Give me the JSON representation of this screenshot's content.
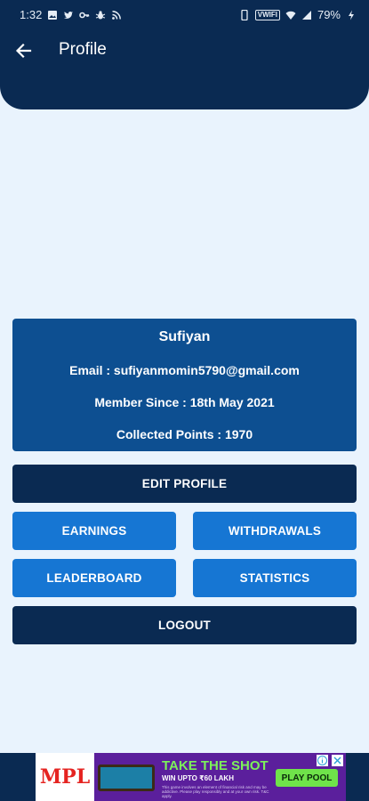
{
  "status_bar": {
    "time": "1:32",
    "carrier_badge": "VWIFI",
    "battery": "79%"
  },
  "header": {
    "title": "Profile"
  },
  "profile": {
    "name": "Sufiyan",
    "email": "Email : sufiyanmomin5790@gmail.com",
    "member_since": "Member Since : 18th May 2021",
    "points": "Collected Points : 1970"
  },
  "buttons": {
    "edit_profile": "EDIT PROFILE",
    "earnings": "EARNINGS",
    "withdrawals": "WITHDRAWALS",
    "leaderboard": "LEADERBOARD",
    "statistics": "STATISTICS",
    "logout": "LOGOUT"
  },
  "ad": {
    "brand": "MPL",
    "headline": "TAKE THE SHOT",
    "subline": "WIN UPTO ₹60 LAKH",
    "fine_print": "This game involves an element of financial risk and may be addictive. Please play responsibly and at your own risk. T&C apply.",
    "cta": "PLAY POOL"
  },
  "colors": {
    "header_bg": "#0a2a52",
    "card_bg": "#0d4f91",
    "dark_button": "#0a2a52",
    "blue_button": "#1676d3",
    "page_bg": "#e9f3fd"
  }
}
